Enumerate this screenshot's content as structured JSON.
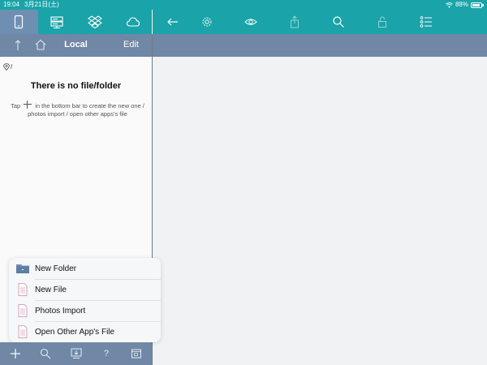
{
  "status_bar": {
    "time": "19:04",
    "date": "3月21日(土)",
    "battery": "88%",
    "battery_level": 0.88
  },
  "left_toolbar": {
    "items": [
      {
        "name": "device-icon",
        "active": true
      },
      {
        "name": "server-icon",
        "active": false
      },
      {
        "name": "dropbox-icon",
        "active": false
      },
      {
        "name": "cloud-icon",
        "active": false
      }
    ]
  },
  "right_toolbar": {
    "items": [
      "back-arrow-icon",
      "gear-icon",
      "eye-icon",
      "share-icon",
      "search-icon",
      "lock-icon",
      "list-icon"
    ]
  },
  "nav": {
    "title": "Local",
    "edit": "Edit"
  },
  "path": "/",
  "empty_state": {
    "title": "There is no file/folder",
    "hint_before": "Tap",
    "hint_after": "in the bottom bar to create the new one / photos import / open other apps's file"
  },
  "popover": {
    "items": [
      {
        "label": "New Folder",
        "icon": "folder-icon"
      },
      {
        "label": "New File",
        "icon": "file-icon"
      },
      {
        "label": "Photos Import",
        "icon": "photos-icon"
      },
      {
        "label": "Open Other App's File",
        "icon": "open-file-icon"
      }
    ]
  },
  "bottom_bar": {
    "items": [
      "plus-icon",
      "search-icon",
      "download-icon",
      "help-icon",
      "window-icon"
    ],
    "help_label": "?"
  },
  "colors": {
    "teal": "#1aa3a8",
    "slate": "#7087a6",
    "active": "#6f8fb2"
  }
}
